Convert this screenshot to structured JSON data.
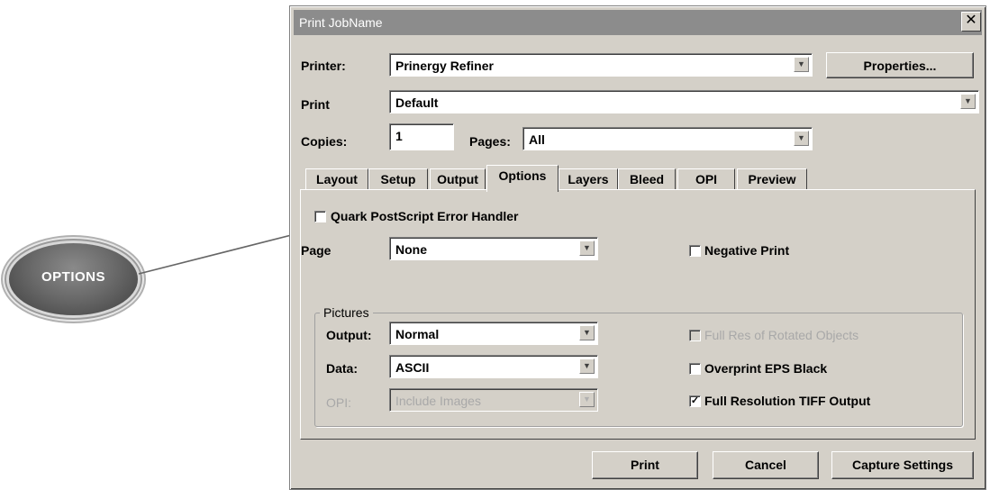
{
  "callout": {
    "label": "OPTIONS"
  },
  "dialog": {
    "title": "Print JobName",
    "close_glyph": "✕",
    "printer": {
      "label": "Printer:",
      "value": "Prinergy Refiner",
      "properties_button": "Properties..."
    },
    "print": {
      "label": "Print",
      "value": "Default"
    },
    "copies": {
      "label": "Copies:",
      "value": "1"
    },
    "pages": {
      "label": "Pages:",
      "value": "All"
    },
    "tabs": [
      "Layout",
      "Setup",
      "Output",
      "Options",
      "Layers",
      "Bleed",
      "OPI",
      "Preview"
    ],
    "active_tab": "Options",
    "options": {
      "error_handler": {
        "label": "Quark PostScript Error Handler",
        "checked": false
      },
      "page": {
        "label": "Page",
        "value": "None"
      },
      "negative_print": {
        "label": "Negative Print",
        "checked": false
      },
      "pictures": {
        "group_label": "Pictures",
        "output": {
          "label": "Output:",
          "value": "Normal"
        },
        "data": {
          "label": "Data:",
          "value": "ASCII"
        },
        "opi": {
          "label": "OPI:",
          "value": "Include Images"
        },
        "full_res_rotated": {
          "label": "Full Res of Rotated Objects",
          "checked": false
        },
        "overprint_eps": {
          "label": "Overprint EPS Black",
          "checked": false
        },
        "full_res_tiff": {
          "label": "Full Resolution TIFF Output",
          "checked": true
        }
      }
    },
    "buttons": {
      "print": "Print",
      "cancel": "Cancel",
      "capture": "Capture Settings"
    }
  },
  "icons": {
    "dropdown": "chevron-down-icon",
    "check": "✓"
  },
  "colors": {
    "titlebar": "#8c8c8c",
    "dialog_bg": "#d4d0c8",
    "callout": "#6a6a6a"
  }
}
